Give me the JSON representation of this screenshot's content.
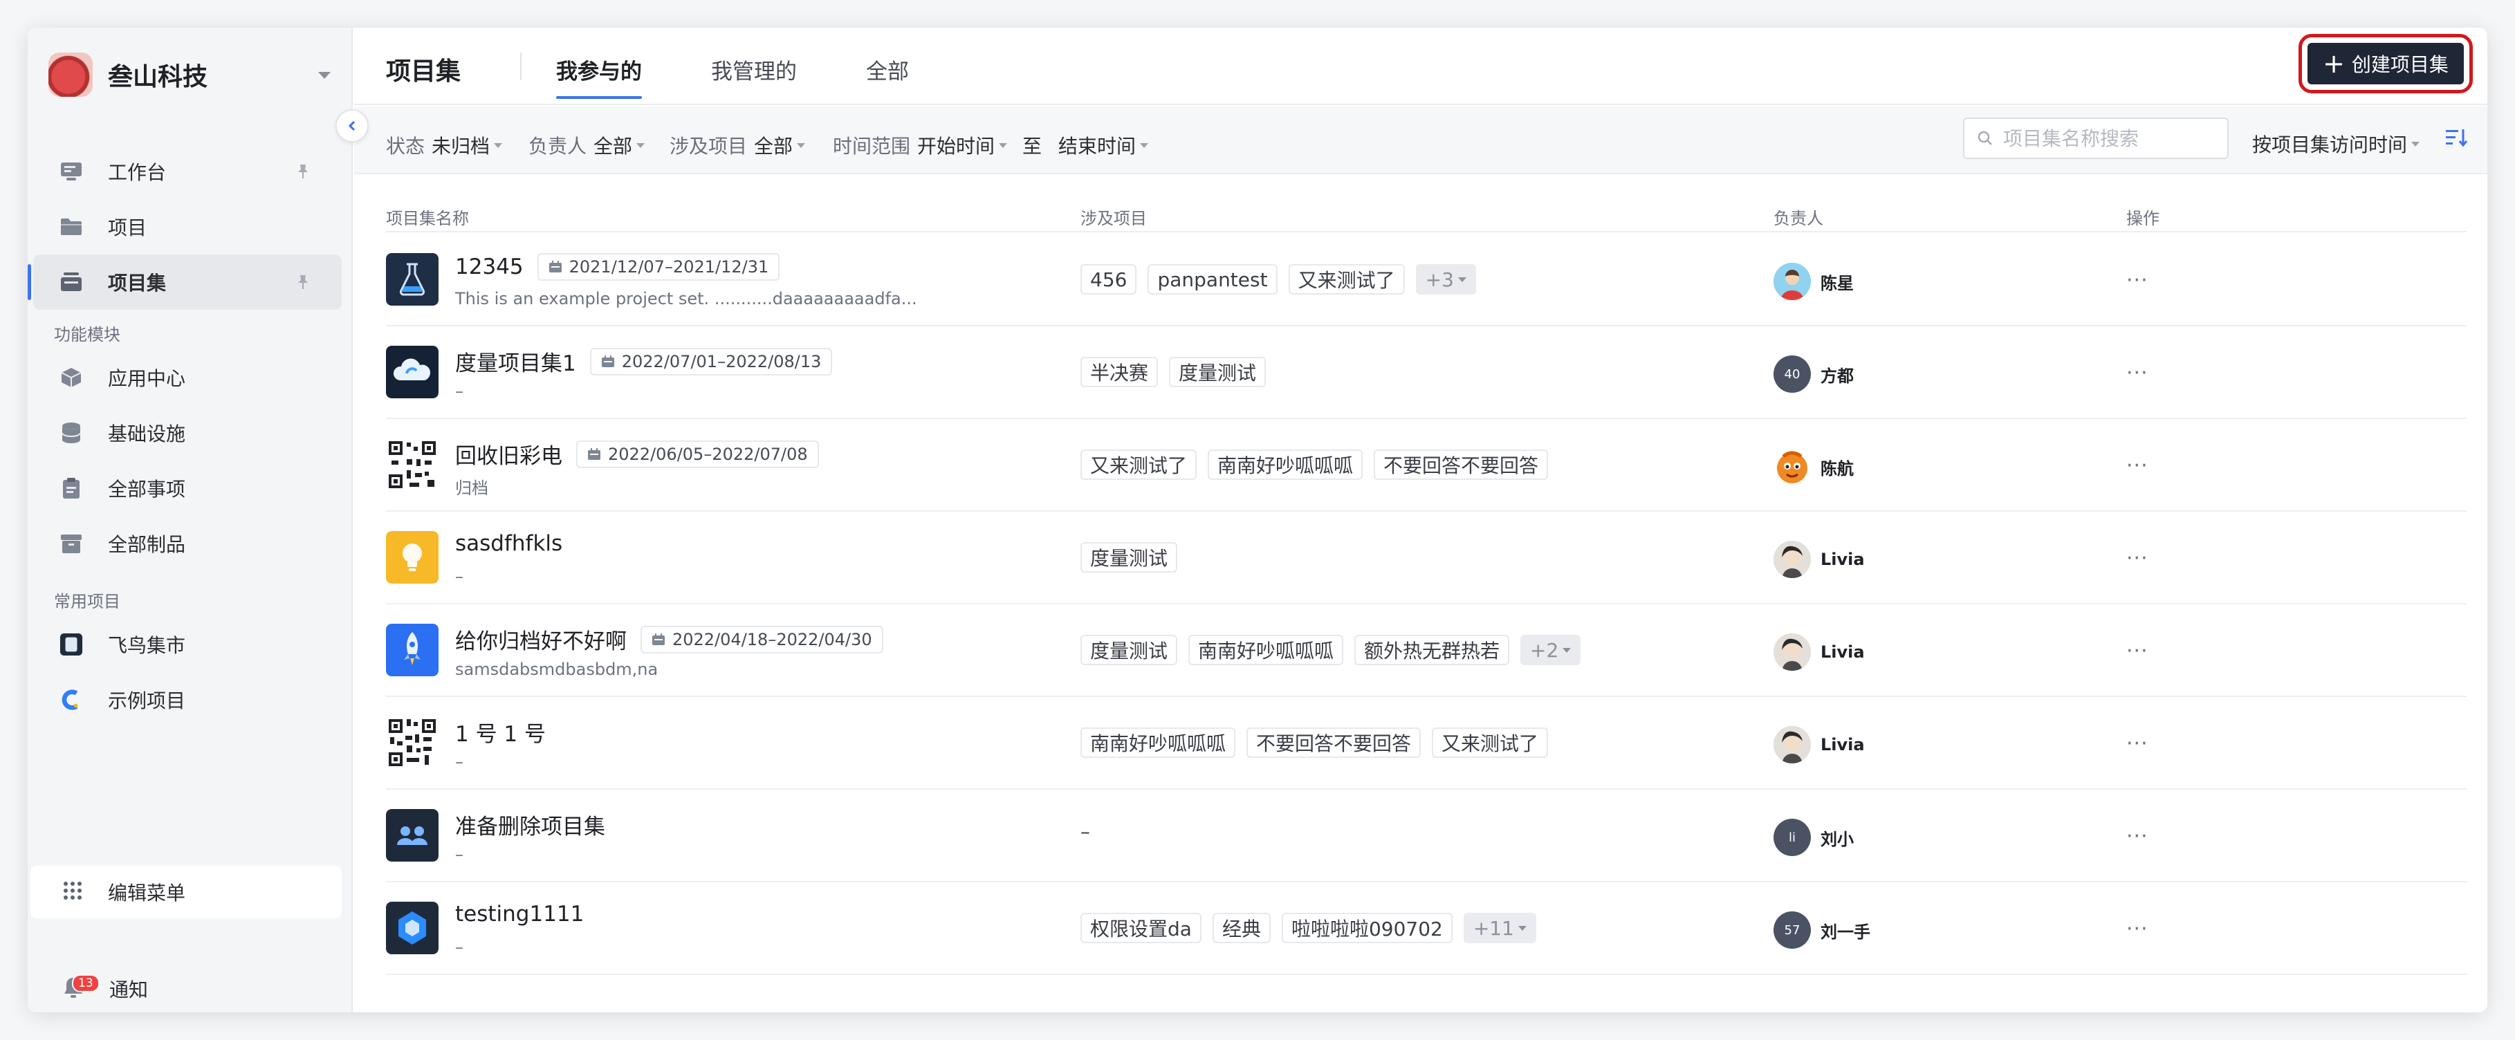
{
  "brand": {
    "name": "叁山科技"
  },
  "sidebar": {
    "items": [
      {
        "label": "工作台",
        "icon": "workbench-icon",
        "pinned": true
      },
      {
        "label": "项目",
        "icon": "folder-icon",
        "pinned": false
      },
      {
        "label": "项目集",
        "icon": "project-set-icon",
        "pinned": true,
        "active": true
      }
    ],
    "section_modules": "功能模块",
    "modules": [
      {
        "label": "应用中心",
        "icon": "cube-icon"
      },
      {
        "label": "基础设施",
        "icon": "database-icon"
      },
      {
        "label": "全部事项",
        "icon": "clipboard-icon"
      },
      {
        "label": "全部制品",
        "icon": "archive-box-icon"
      }
    ],
    "section_projects": "常用项目",
    "projects": [
      {
        "label": "飞鸟集市"
      },
      {
        "label": "示例项目"
      }
    ],
    "edit_menu": "编辑菜单",
    "notify": {
      "label": "通知",
      "badge": "13"
    }
  },
  "header": {
    "title": "项目集",
    "tabs": [
      "我参与的",
      "我管理的",
      "全部"
    ],
    "active_tab": "我参与的",
    "create_button": "创建项目集"
  },
  "filters": {
    "status": {
      "label": "状态",
      "value": "未归档"
    },
    "owner": {
      "label": "负责人",
      "value": "全部"
    },
    "projects": {
      "label": "涉及项目",
      "value": "全部"
    },
    "time_range": {
      "label": "时间范围",
      "start": "开始时间",
      "sep": "至",
      "end": "结束时间"
    },
    "search_placeholder": "项目集名称搜索",
    "sort": "按项目集访问时间"
  },
  "table": {
    "headers": [
      "项目集名称",
      "涉及项目",
      "负责人",
      "操作"
    ],
    "rows": [
      {
        "name": "12345",
        "date": "2021/12/07–2021/12/31",
        "desc": "This is an example project set. ...........daaaaaaaaadfa...",
        "tags": [
          "456",
          "panpantest",
          "又来测试了"
        ],
        "more": "+3",
        "owner": "陈星",
        "avatar_text": ""
      },
      {
        "name": "度量项目集1",
        "date": "2022/07/01–2022/08/13",
        "desc": "–",
        "tags": [
          "半决赛",
          "度量测试"
        ],
        "more": "",
        "owner": "方都",
        "avatar_text": "40"
      },
      {
        "name": "回收旧彩电",
        "date": "2022/06/05–2022/07/08",
        "desc": "归档",
        "tags": [
          "又来测试了",
          "南南好吵呱呱呱",
          "不要回答不要回答"
        ],
        "more": "",
        "owner": "陈航",
        "avatar_text": ""
      },
      {
        "name": "sasdfhfkls",
        "date": "",
        "desc": "–",
        "tags": [
          "度量测试"
        ],
        "more": "",
        "owner": "Livia",
        "avatar_text": ""
      },
      {
        "name": "给你归档好不好啊",
        "date": "2022/04/18–2022/04/30",
        "desc": "samsdabsmdbasbdm,na",
        "tags": [
          "度量测试",
          "南南好吵呱呱呱",
          "额外热无群热若"
        ],
        "more": "+2",
        "owner": "Livia",
        "avatar_text": ""
      },
      {
        "name": "1 号 1 号",
        "date": "",
        "desc": "–",
        "tags": [
          "南南好吵呱呱呱",
          "不要回答不要回答",
          "又来测试了"
        ],
        "more": "",
        "owner": "Livia",
        "avatar_text": ""
      },
      {
        "name": "准备删除项目集",
        "date": "",
        "desc": "–",
        "tags": [],
        "tags_empty": "–",
        "more": "",
        "owner": "刘小",
        "avatar_text": "li"
      },
      {
        "name": "testing1111",
        "date": "",
        "desc": "–",
        "tags": [
          "权限设置da",
          "经典",
          "啦啦啦啦090702"
        ],
        "more": "+11",
        "owner": "刘一手",
        "avatar_text": "57"
      }
    ],
    "row_action": "···"
  },
  "colors": {
    "accent": "#3b73f0",
    "primary_button": "#1f2736",
    "highlight_outline": "#d0191c"
  }
}
